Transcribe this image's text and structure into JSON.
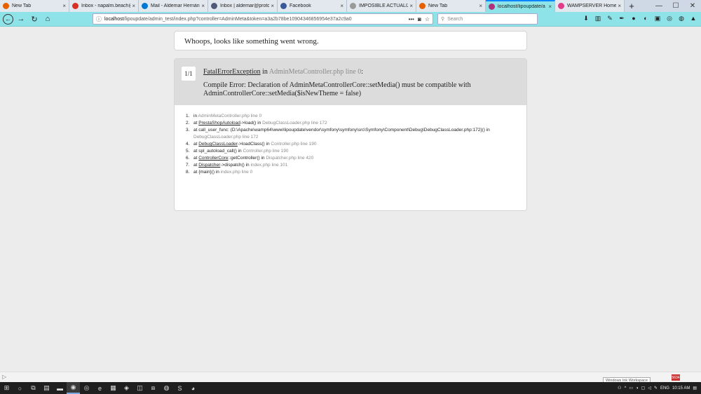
{
  "tabs": [
    {
      "title": "New Tab",
      "color": "#e66000",
      "active": false
    },
    {
      "title": "Inbox - napalm.beach@",
      "color": "#d93025",
      "active": false
    },
    {
      "title": "Mail - Aldemar Hernánd",
      "color": "#0078d4",
      "active": false
    },
    {
      "title": "Inbox | aldemar@protc",
      "color": "#505a7a",
      "active": false
    },
    {
      "title": "Facebook",
      "color": "#3b5998",
      "active": false
    },
    {
      "title": "IMPOSIBLE ACTUALIZA",
      "color": "#999999",
      "active": false
    },
    {
      "title": "New Tab",
      "color": "#e66000",
      "active": false
    },
    {
      "title": "localhost/lipoupdate/a",
      "color": "#b0307a",
      "active": true
    },
    {
      "title": "WAMPSERVER Homepa",
      "color": "#e03c8a",
      "active": false
    }
  ],
  "url": {
    "host": "localhost",
    "path": "/lipoupdate/admin_test/index.php?controller=AdminMeta&token=a3a2b78be10904346856954e37a2c9a0"
  },
  "search_placeholder": "Search",
  "error": {
    "title": "Whoops, looks like something went wrong.",
    "counter": "1/1",
    "exception_class": "FatalErrorException",
    "in_word": "in",
    "location": "AdminMetaController.php line 0",
    "message": "Compile Error: Declaration of AdminMetaControllerCore::setMedia() must be compatible with AdminControllerCore::setMedia($isNewTheme = false)"
  },
  "trace": [
    {
      "n": "1.",
      "pre": "in ",
      "link": "",
      "post": "",
      "loc": "AdminMetaController.php line 0"
    },
    {
      "n": "2.",
      "pre": "at ",
      "link": "PrestaShopAutoload",
      "post": "->load() in ",
      "loc": "DebugClassLoader.php line 172"
    },
    {
      "n": "3.",
      "pre": "at call_user_func: (D:\\Apache\\wamp64\\www\\lipoupdate\\vendor\\symfony\\symfony\\src\\Symfony\\Component\\Debug\\DebugClassLoader.php:172}() in ",
      "link": "",
      "post": "",
      "loc": "DebugClassLoader.php line 172"
    },
    {
      "n": "4.",
      "pre": "at ",
      "link": "DebugClassLoader",
      "post": "->loadClass() in ",
      "loc": "Controller.php line 190"
    },
    {
      "n": "5.",
      "pre": "at spl_autoload_call() in ",
      "link": "",
      "post": "",
      "loc": "Controller.php line 190"
    },
    {
      "n": "6.",
      "pre": "at ",
      "link": "ControllerCore",
      "post": "::getController() in ",
      "loc": "Dispatcher.php line 420"
    },
    {
      "n": "7.",
      "pre": "at ",
      "link": "Dispatcher",
      "post": "->dispatch() in ",
      "loc": "index.php line 101"
    },
    {
      "n": "8.",
      "pre": "at {main}() in ",
      "link": "",
      "post": "",
      "loc": "index.php line 0"
    }
  ],
  "status": {
    "ink_workspace": "Windows Ink Workspace",
    "badge": "5634"
  },
  "tray": {
    "lang": "ENG",
    "time": "10:15 AM"
  }
}
